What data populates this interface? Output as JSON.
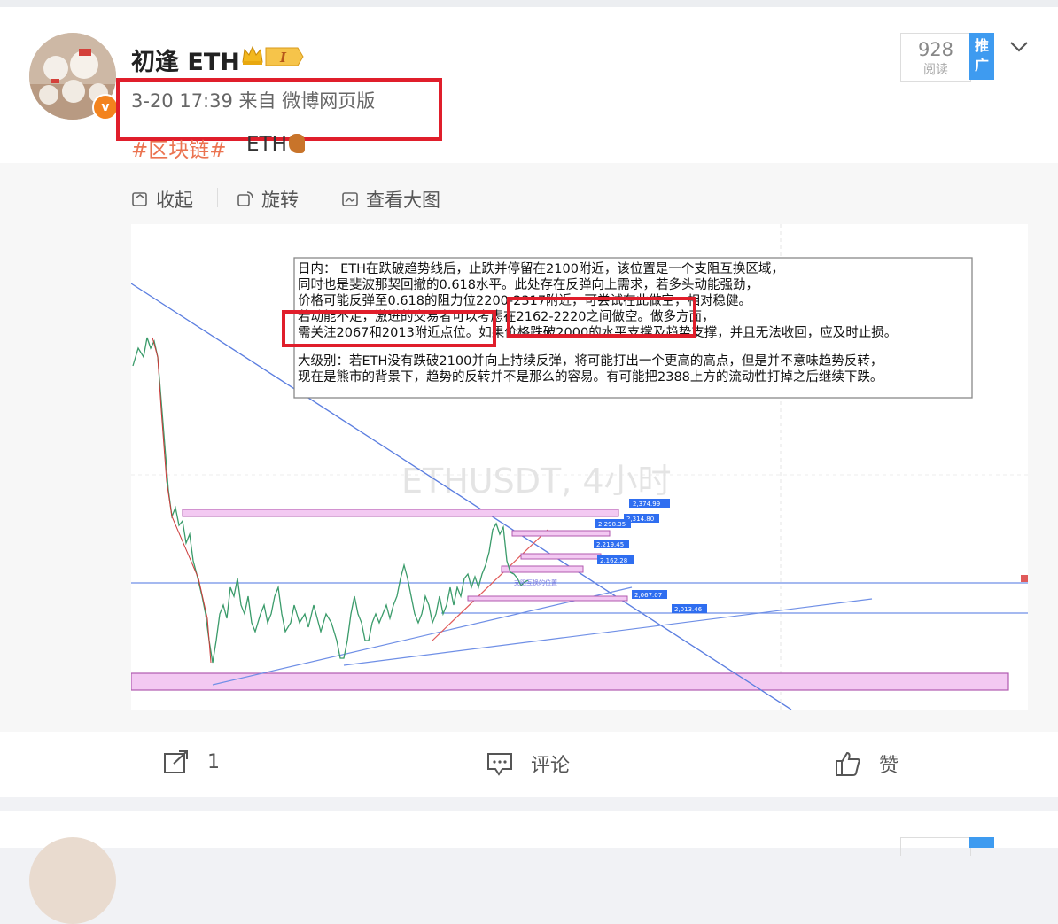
{
  "post": {
    "username": "初逢 ETH",
    "level": "I",
    "meta": "3-20 17:39  来自 微博网页版",
    "topic": "#区块链#",
    "topic_suffix": "ETH",
    "read_count": "928",
    "read_label": "阅读",
    "promote_label": "推广"
  },
  "toolbar": {
    "collapse": "收起",
    "rotate": "旋转",
    "view_large": "查看大图"
  },
  "annotation": {
    "line1": "日内：  ETH在跌破趋势线后，止跌并停留在2100附近，该位置是一个支阻互换区域，",
    "line2": "同时也是斐波那契回撤的0.618水平。此处存在反弹向上需求，若多头动能强劲，",
    "line3": "价格可能反弹至0.618的阻力位2200-2317附近，可尝试在此做空，相对稳健。",
    "line4": "若动能不足，激进的交易者可以考虑在2162-2220之间做空。做多方面，",
    "line5": "需关注2067和2013附近点位。如果价格跌破2000的水平支撑及趋势支撑，并且无法收回，应及时止损。",
    "line6": "大级别：若ETH没有跌破2100并向上持续反弹，将可能打出一个更高的高点，但是并不意味趋势反转，",
    "line7": "现在是熊市的背景下，趋势的反转并不是那么的容易。有可能把2388上方的流动性打掉之后继续下跌。"
  },
  "chart": {
    "watermark": "ETHUSDT, 4小时",
    "price_tags": [
      "2,374.99",
      "2,314.80",
      "2,298.35",
      "2,219.45",
      "2,162.28",
      "2,067.07",
      "2,013.46"
    ],
    "zone_label": "支阻互换的位置"
  },
  "footer": {
    "share_count": "1",
    "comment_label": "评论",
    "like_label": "赞"
  },
  "colors": {
    "accent_orange": "#eb7350",
    "highlight_red": "#e01e2b",
    "promote_blue": "#3e9bf0"
  }
}
